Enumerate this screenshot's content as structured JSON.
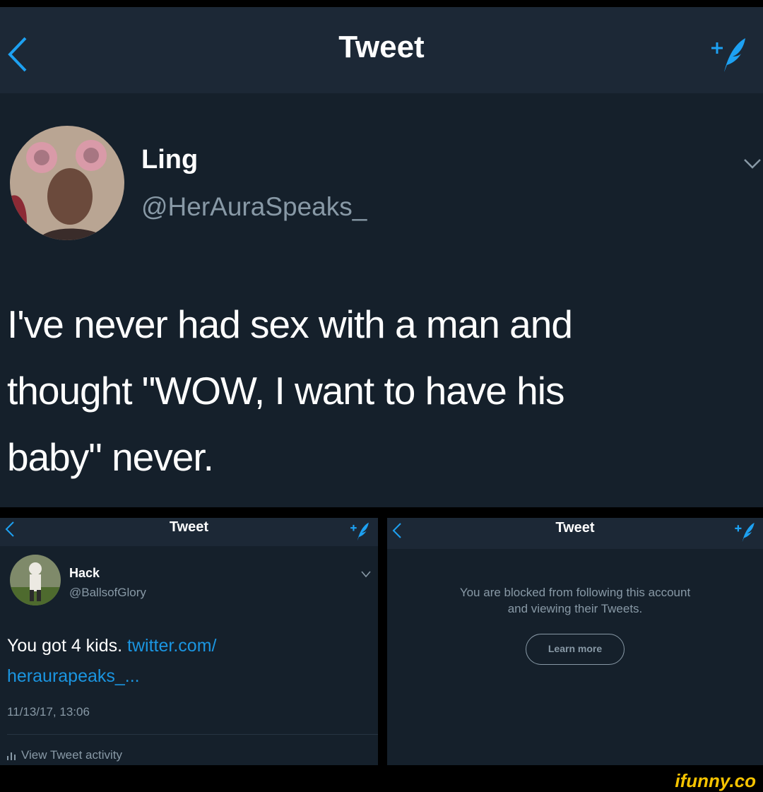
{
  "main_tweet": {
    "header_title": "Tweet",
    "author_name": "Ling",
    "author_handle": "@HerAuraSpeaks_",
    "text_lines": [
      "I've never had sex with a man and",
      "thought \"WOW, I want to have his",
      "baby\" never."
    ]
  },
  "reply_tweet": {
    "header_title": "Tweet",
    "author_name": "Hack",
    "author_handle": "@BallsofGlory",
    "text_prefix": "You got 4 kids. ",
    "link_line1": "twitter.com/",
    "link_line2": "heraurapeaks_...",
    "timestamp": "11/13/17, 13:06",
    "activity_label": "View Tweet activity"
  },
  "blocked_panel": {
    "header_title": "Tweet",
    "message_line1": "You are blocked from following this account",
    "message_line2": "and viewing their Tweets.",
    "learn_more_label": "Learn more"
  },
  "watermark": "ifunny.co",
  "colors": {
    "background": "#15202b",
    "header": "#1c2836",
    "accent": "#1da1f2",
    "muted_text": "#8899a6",
    "watermark": "#f5c300"
  },
  "icons": [
    "back-chevron-icon",
    "compose-tweet-icon",
    "dropdown-chevron-icon",
    "bar-chart-icon"
  ]
}
